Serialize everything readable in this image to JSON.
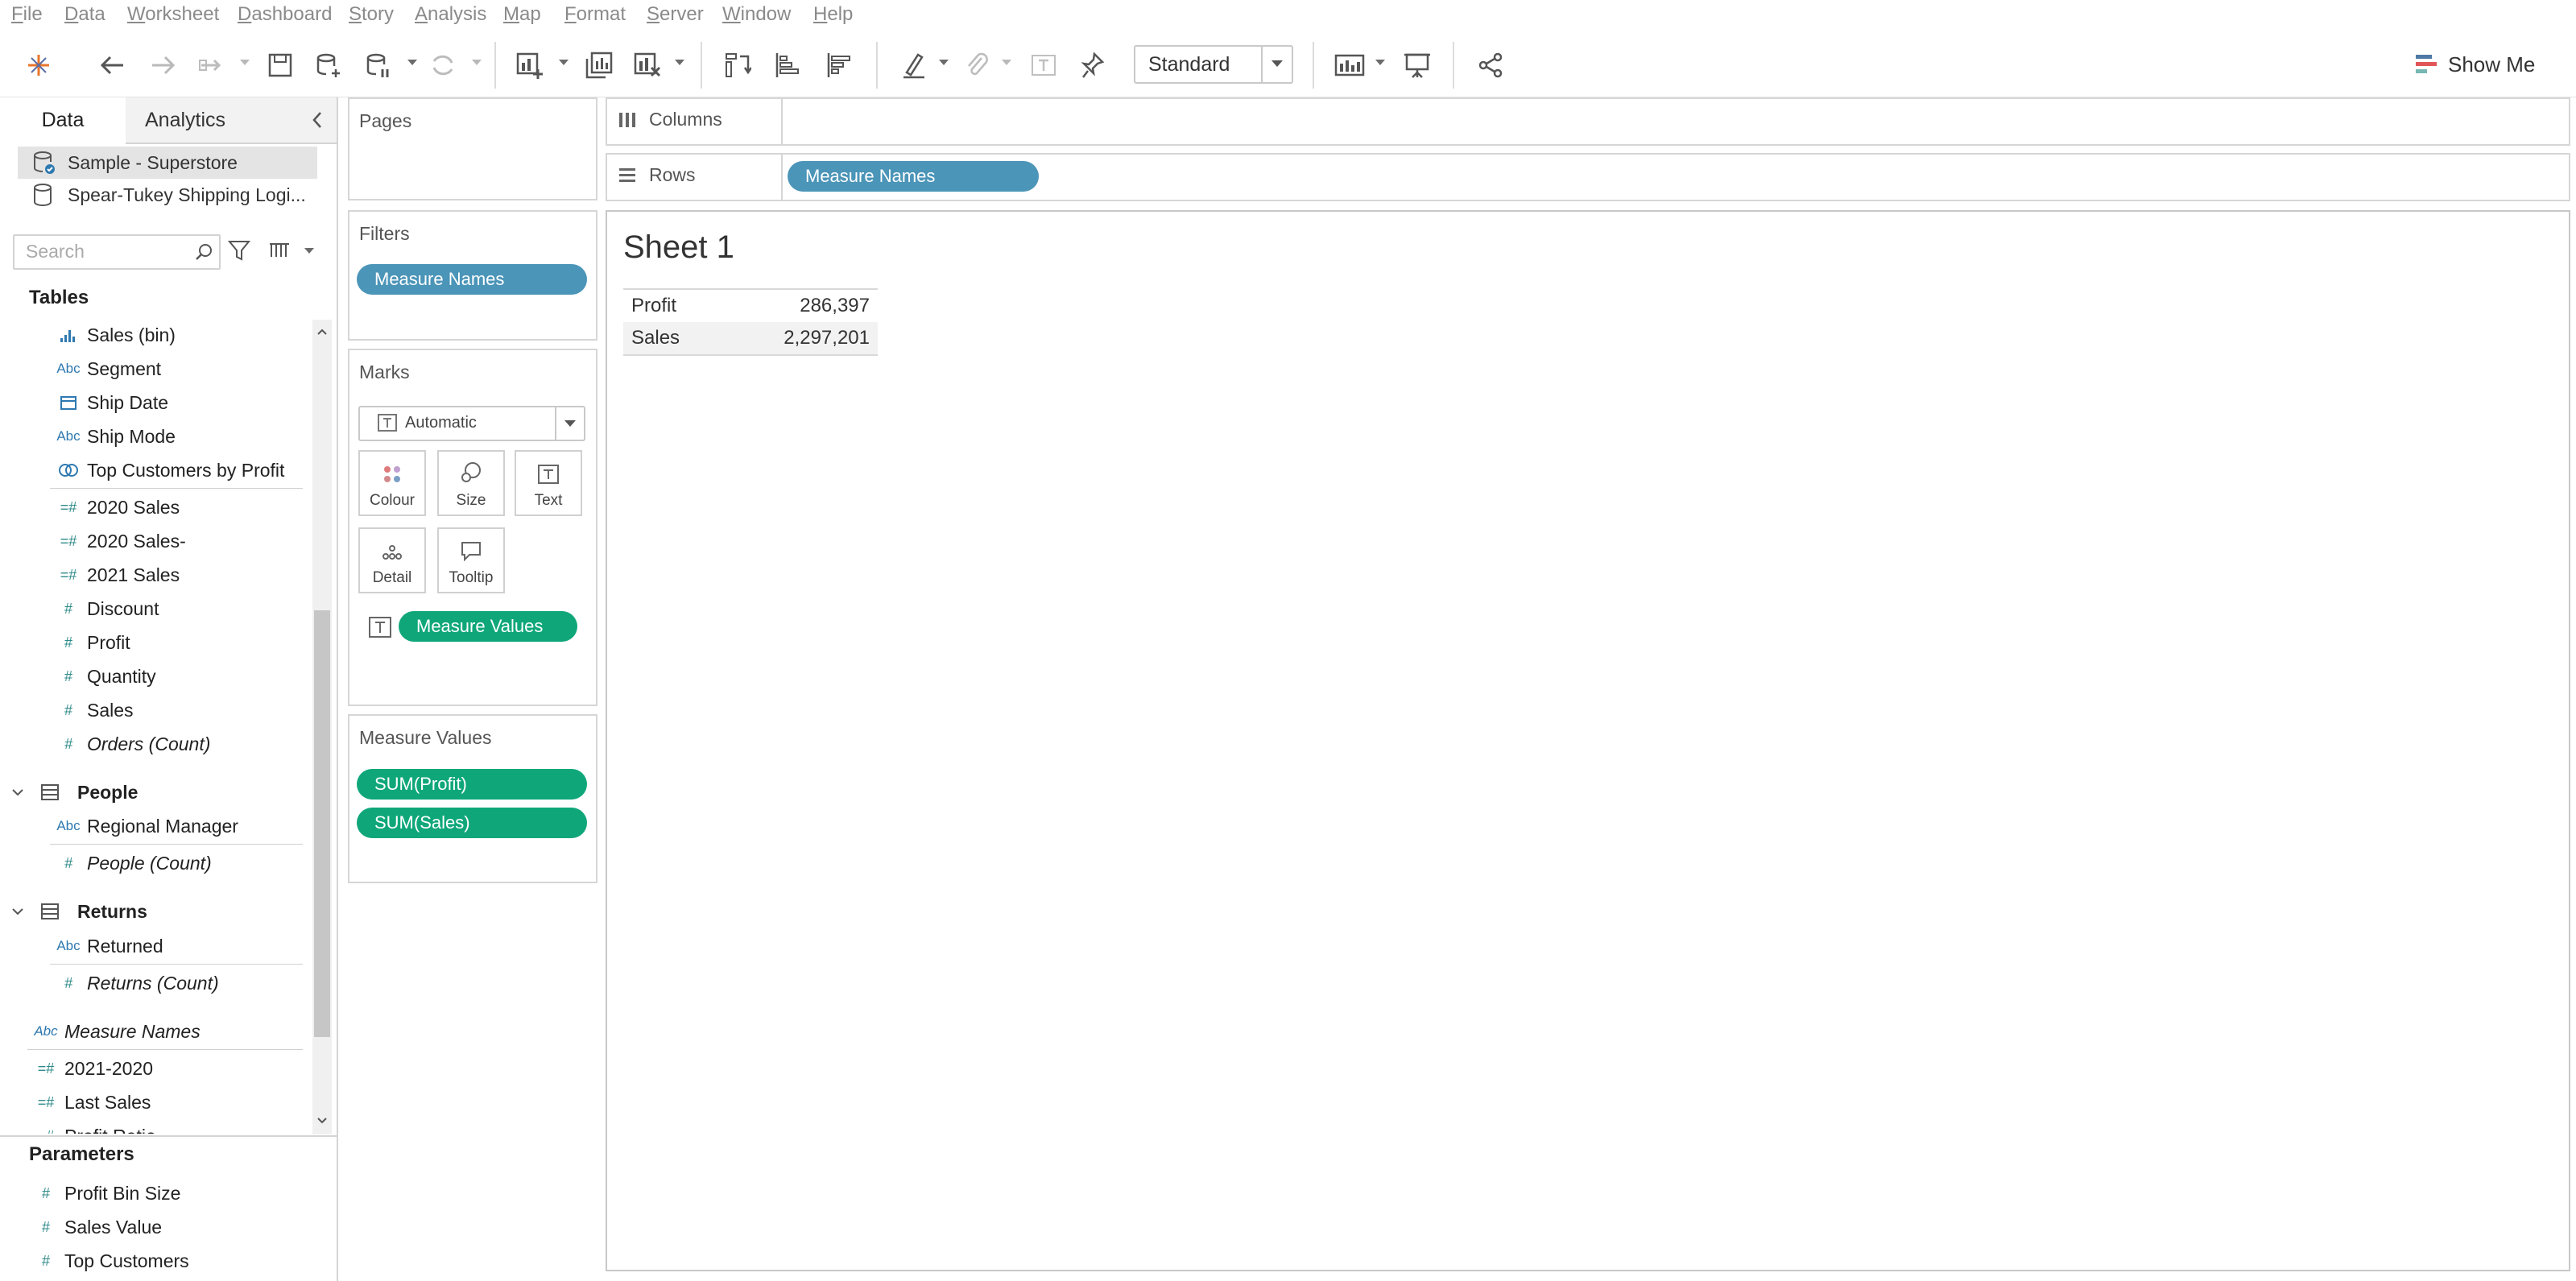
{
  "menu": [
    {
      "pre": "",
      "ul": "F",
      "post": "ile"
    },
    {
      "pre": "",
      "ul": "D",
      "post": "ata"
    },
    {
      "pre": "",
      "ul": "W",
      "post": "orksheet"
    },
    {
      "pre": "",
      "ul": "D",
      "post": "ashboard"
    },
    {
      "pre": "",
      "ul": "S",
      "post": "tory"
    },
    {
      "pre": "",
      "ul": "A",
      "post": "nalysis"
    },
    {
      "pre": "",
      "ul": "M",
      "post": "ap"
    },
    {
      "pre": "",
      "ul": "F",
      "post": "ormat"
    },
    {
      "pre": "",
      "ul": "S",
      "post": "erver"
    },
    {
      "pre": "",
      "ul": "W",
      "post": "indow"
    },
    {
      "pre": "",
      "ul": "H",
      "post": "elp"
    }
  ],
  "toolbar": {
    "fit_select": "Standard",
    "show_me": "Show Me",
    "icons": [
      "tableau-logo-icon",
      "undo-icon",
      "redo-icon",
      "replay-icon",
      "save-icon",
      "new-data-source-icon",
      "pause-updates-icon",
      "refresh-icon",
      "new-worksheet-icon",
      "duplicate-sheet-icon",
      "clear-sheet-icon",
      "swap-rows-columns-icon",
      "sort-ascending-icon",
      "sort-descending-icon",
      "highlight-icon",
      "group-icon",
      "show-labels-icon",
      "pin-axis-icon",
      "view-cards-icon",
      "presentation-mode-icon",
      "share-icon"
    ]
  },
  "left_panel": {
    "tab_data": "Data",
    "tab_analytics": "Analytics",
    "data_sources": [
      "Sample - Superstore",
      "Spear-Tukey Shipping Logi..."
    ],
    "search_placeholder": "Search",
    "tables_header": "Tables",
    "orders_fields": [
      {
        "icon": "bin",
        "name": "Sales (bin)"
      },
      {
        "icon": "abc",
        "name": "Segment"
      },
      {
        "icon": "date",
        "name": "Ship Date"
      },
      {
        "icon": "abc",
        "name": "Ship Mode"
      },
      {
        "icon": "set",
        "name": "Top Customers by Profit"
      }
    ],
    "orders_measures": [
      {
        "icon": "calc",
        "name": "2020 Sales"
      },
      {
        "icon": "calc",
        "name": "2020 Sales-"
      },
      {
        "icon": "calc",
        "name": "2021 Sales"
      },
      {
        "icon": "num",
        "name": "Discount"
      },
      {
        "icon": "num",
        "name": "Profit"
      },
      {
        "icon": "num",
        "name": "Quantity"
      },
      {
        "icon": "num",
        "name": "Sales"
      },
      {
        "icon": "num",
        "name": "Orders (Count)",
        "italic": true
      }
    ],
    "people": {
      "title": "People",
      "fields": [
        {
          "icon": "abc",
          "name": "Regional Manager"
        },
        {
          "icon": "num",
          "name": "People (Count)",
          "italic": true
        }
      ]
    },
    "returns": {
      "title": "Returns",
      "fields": [
        {
          "icon": "abc",
          "name": "Returned"
        },
        {
          "icon": "num",
          "name": "Returns (Count)",
          "italic": true
        }
      ]
    },
    "measure_names": "Measure Names",
    "loose_fields": [
      {
        "icon": "calc",
        "name": "2021-2020"
      },
      {
        "icon": "calc",
        "name": "Last Sales"
      },
      {
        "icon": "calc",
        "name": "Profit Ratio"
      }
    ],
    "parameters_header": "Parameters",
    "parameters": [
      {
        "icon": "num",
        "name": "Profit Bin Size"
      },
      {
        "icon": "num",
        "name": "Sales Value"
      },
      {
        "icon": "num",
        "name": "Top Customers"
      }
    ]
  },
  "cards": {
    "pages": "Pages",
    "filters": "Filters",
    "filter_pill": "Measure Names",
    "marks": "Marks",
    "mark_type": "Automatic",
    "mark_buttons": [
      "Colour",
      "Size",
      "Text",
      "Detail",
      "Tooltip"
    ],
    "text_pill": "Measure Values",
    "measure_values": "Measure Values",
    "measure_pills": [
      "SUM(Profit)",
      "SUM(Sales)"
    ]
  },
  "shelves": {
    "columns": "Columns",
    "rows": "Rows",
    "rows_pill": "Measure Names"
  },
  "view": {
    "sheet_title": "Sheet 1",
    "rows": [
      {
        "name": "Profit",
        "value": "286,397"
      },
      {
        "name": "Sales",
        "value": "2,297,201"
      }
    ]
  },
  "colors": {
    "dimension_pill": "#4b95b8",
    "measure_pill": "#0fa77a"
  }
}
